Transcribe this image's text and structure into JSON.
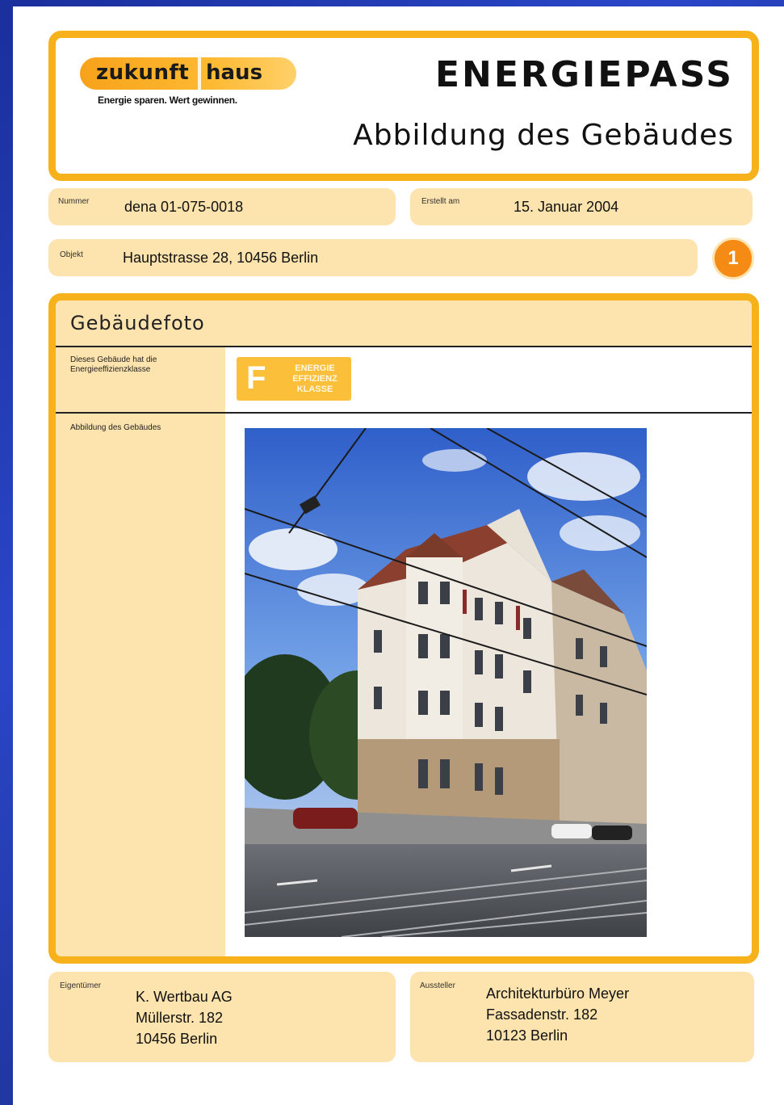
{
  "colors": {
    "accent": "#f7b21b",
    "pill": "#fde3ad",
    "badge": "#f58a14"
  },
  "header": {
    "logo_left": "zukunft",
    "logo_right": "haus",
    "logo_tagline": "Energie sparen. Wert gewinnen.",
    "title": "ENERGIEPASS",
    "subtitle": "Abbildung des Gebäudes"
  },
  "fields": {
    "nummer_label": "Nummer",
    "nummer_value": "dena 01-075-0018",
    "erstellt_label": "Erstellt am",
    "erstellt_value": "15. Januar 2004",
    "objekt_label": "Objekt",
    "objekt_value": "Hauptstrasse 28, 10456 Berlin",
    "page_badge": "1"
  },
  "main": {
    "title": "Gebäudefoto",
    "efficiency_label": "Dieses Gebäude hat die Energieeffizienzklasse",
    "efficiency_class": "F",
    "efficiency_badge_text": "ENERGIE EFFIZIENZ KLASSE",
    "photo_label": "Abbildung des Gebäudes",
    "photo_icon": "building-photo"
  },
  "owner": {
    "label": "Eigentümer",
    "lines": [
      "K. Wertbau AG",
      "Müllerstr. 182",
      "10456 Berlin"
    ]
  },
  "issuer": {
    "label": "Aussteller",
    "lines": [
      "Architekturbüro Meyer",
      "Fassadenstr. 182",
      "10123 Berlin"
    ]
  }
}
